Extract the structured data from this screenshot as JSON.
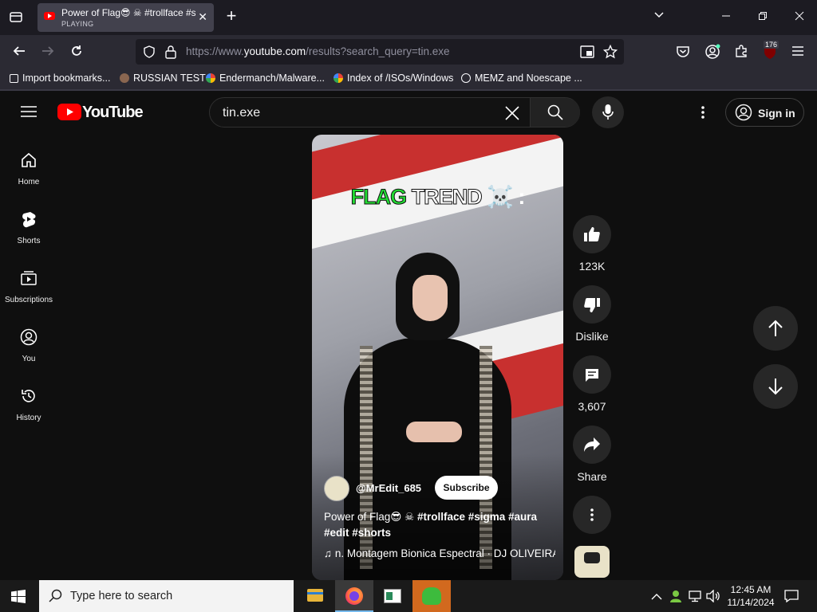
{
  "browser": {
    "tab": {
      "title": "Power of Flag😎 ☠ #trollface #sigma #aura",
      "status": "PLAYING",
      "close": "✕"
    },
    "new_tab": "+",
    "url": {
      "prefix": "https://www.",
      "host": "youtube.com",
      "path": "/results?search_query=tin.exe"
    },
    "extension_badge": "176",
    "bookmarks": [
      {
        "label": "Import bookmarks...",
        "icon": "import-icon"
      },
      {
        "label": "RUSSIAN TEST",
        "icon": "user-avatar-icon"
      },
      {
        "label": "Endermanch/Malware...",
        "icon": "google-icon"
      },
      {
        "label": "Index of /ISOs/Windows",
        "icon": "google-icon"
      },
      {
        "label": "MEMZ and Noescape ...",
        "icon": "globe-icon"
      }
    ]
  },
  "youtube": {
    "logo_text": "YouTube",
    "search_value": "tin.exe",
    "sign_in": "Sign in",
    "sidebar": [
      {
        "label": "Home",
        "icon": "home-icon"
      },
      {
        "label": "Shorts",
        "icon": "shorts-icon"
      },
      {
        "label": "Subscriptions",
        "icon": "subscriptions-icon"
      },
      {
        "label": "You",
        "icon": "account-icon"
      },
      {
        "label": "History",
        "icon": "history-icon"
      }
    ],
    "short": {
      "overlay_text_1": "FLAG",
      "overlay_text_2": "TREND",
      "overlay_text_3": "☠️ :",
      "channel": "@MrEdit_685",
      "subscribe": "Subscribe",
      "title_plain": "Power of Flag😎 ☠ ",
      "title_tags": "#trollface #sigma #aura #edit #shorts",
      "music": "♫ n. Montagem Bionica Espectral · DJ OLIVEIRA"
    },
    "actions": {
      "likes": "123K",
      "dislike": "Dislike",
      "comments": "3,607",
      "share": "Share"
    }
  },
  "taskbar": {
    "search_placeholder": "Type here to search",
    "time": "12:45 AM",
    "date": "11/14/2024"
  },
  "colors": {
    "youtube_red": "#ff0000",
    "flag_green": "#22dd33",
    "background": "#0f0f0f"
  }
}
